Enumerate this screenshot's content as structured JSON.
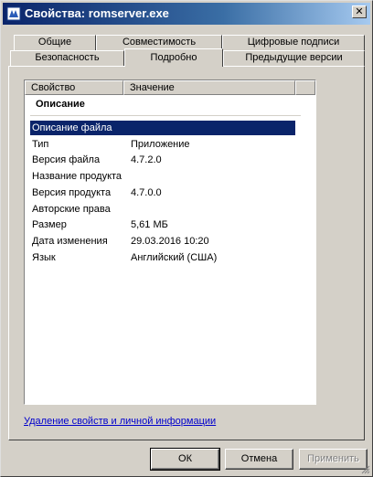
{
  "window": {
    "title": "Свойства: romserver.exe",
    "close_glyph": "✕"
  },
  "tabs": [
    {
      "label": "Общие",
      "active": false
    },
    {
      "label": "Совместимость",
      "active": false
    },
    {
      "label": "Цифровые подписи",
      "active": false
    },
    {
      "label": "Безопасность",
      "active": false
    },
    {
      "label": "Подробно",
      "active": true
    },
    {
      "label": "Предыдущие версии",
      "active": false
    }
  ],
  "list": {
    "columns": [
      "Свойство",
      "Значение"
    ],
    "group_title": "Описание",
    "rows": [
      {
        "key": "Описание файла",
        "value": "",
        "selected": true
      },
      {
        "key": "Тип",
        "value": "Приложение"
      },
      {
        "key": "Версия файла",
        "value": "4.7.2.0"
      },
      {
        "key": "Название продукта",
        "value": ""
      },
      {
        "key": "Версия продукта",
        "value": "4.7.0.0"
      },
      {
        "key": "Авторские права",
        "value": ""
      },
      {
        "key": "Размер",
        "value": "5,61 МБ"
      },
      {
        "key": "Дата изменения",
        "value": "29.03.2016 10:20"
      },
      {
        "key": "Язык",
        "value": "Английский (США)"
      }
    ]
  },
  "link_text": "Удаление свойств и личной информации",
  "buttons": {
    "ok": "ОК",
    "cancel": "Отмена",
    "apply": "Применить"
  },
  "icons": {
    "title_icon": "app-icon",
    "close": "close-icon",
    "grip": "resize-grip-icon"
  }
}
